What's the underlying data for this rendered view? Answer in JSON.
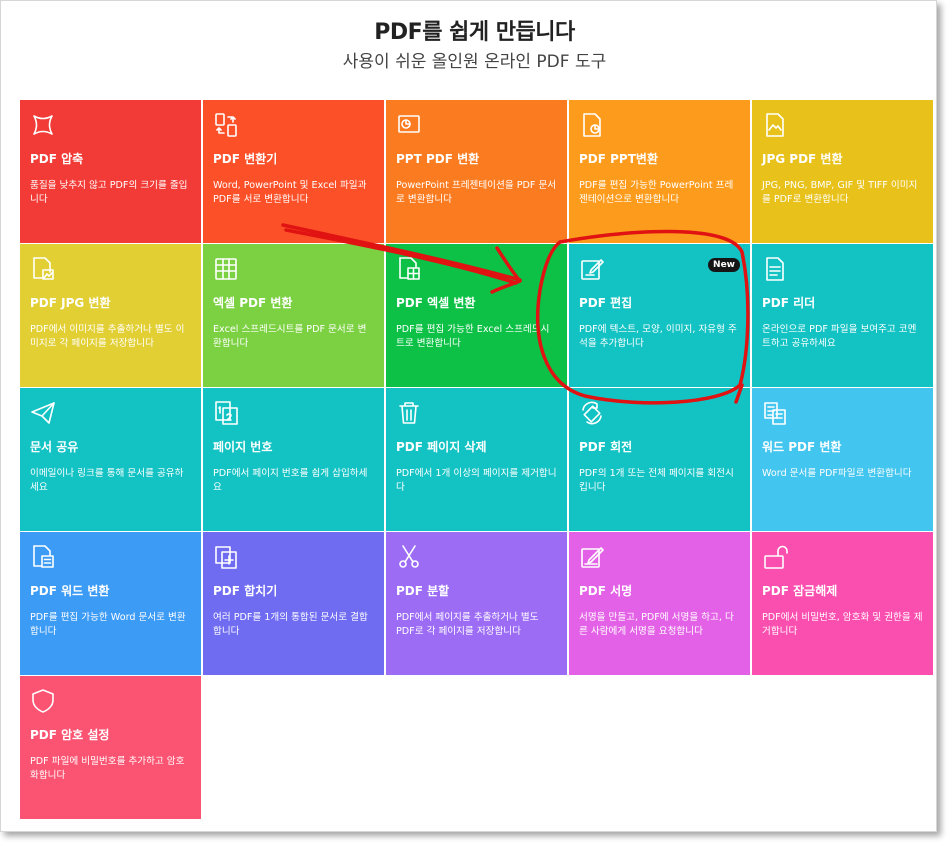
{
  "header": {
    "title": "PDF를 쉽게 만듭니다",
    "subtitle": "사용이 쉬운 올인원 온라인 PDF 도구"
  },
  "tools": [
    {
      "icon": "compress-icon",
      "name": "PDF 압축",
      "desc": "품질을 낮추지 않고 PDF의 크기를 줄입니다",
      "color": "#f23b36"
    },
    {
      "icon": "convert-icon",
      "name": "PDF 변환기",
      "desc": "Word, PowerPoint 및 Excel 파일과 PDF를 서로 변환합니다",
      "color": "#fb5028"
    },
    {
      "icon": "ppt-icon",
      "name": "PPT PDF 변환",
      "desc": "PowerPoint 프레젠테이션을 PDF 문서로 변환합니다",
      "color": "#fb7c20"
    },
    {
      "icon": "pdf-ppt-icon",
      "name": "PDF PPT변환",
      "desc": "PDF를 편집 가능한 PowerPoint 프레젠테이션으로 변환합니다",
      "color": "#fd9c1c"
    },
    {
      "icon": "image-icon",
      "name": "JPG PDF 변환",
      "desc": "JPG, PNG, BMP, GIF 및 TIFF 이미지를 PDF로 변환합니다",
      "color": "#e8c21a"
    },
    {
      "icon": "pdf-jpg-icon",
      "name": "PDF JPG 변환",
      "desc": "PDF에서 이미지를 추출하거나 별도 이미지로 각 페이지를 저장합니다",
      "color": "#e2cf33"
    },
    {
      "icon": "excel-icon",
      "name": "엑셀 PDF 변환",
      "desc": "Excel 스프레드시트를 PDF 문서로 변환합니다",
      "color": "#7cd142"
    },
    {
      "icon": "pdf-excel-icon",
      "name": "PDF 엑셀 변환",
      "desc": "PDF를 편집 가능한 Excel 스프레드시트로 변환합니다",
      "color": "#0cc145"
    },
    {
      "icon": "edit-icon",
      "name": "PDF 편집",
      "desc": "PDF에 텍스트, 모양, 이미지, 자유형 주석을 추가합니다",
      "color": "#13c3c4",
      "badge": "New"
    },
    {
      "icon": "reader-icon",
      "name": "PDF 리더",
      "desc": "온라인으로 PDF 파일을 보여주고 코멘트하고 공유하세요",
      "color": "#13c3c4"
    },
    {
      "icon": "share-icon",
      "name": "문서 공유",
      "desc": "이메일이나 링크를 통해 문서를 공유하세요",
      "color": "#13c3c4"
    },
    {
      "icon": "page-number-icon",
      "name": "페이지 번호",
      "desc": "PDF에서 페이지 번호를 쉽게 삽입하세요",
      "color": "#13c3c4"
    },
    {
      "icon": "trash-icon",
      "name": "PDF 페이지 삭제",
      "desc": "PDF에서 1개 이상의 페이지를 제거합니다",
      "color": "#13c3c4"
    },
    {
      "icon": "rotate-icon",
      "name": "PDF 회전",
      "desc": "PDF의 1개 또는 전체 페이지를 회전시킵니다",
      "color": "#13c3c4"
    },
    {
      "icon": "word-icon",
      "name": "워드 PDF 변환",
      "desc": "Word 문서를 PDF파일로 변환합니다",
      "color": "#42c5ee"
    },
    {
      "icon": "pdf-word-icon",
      "name": "PDF 워드 변환",
      "desc": "PDF를 편집 가능한 Word 문서로 변환합니다",
      "color": "#3c9bf5"
    },
    {
      "icon": "merge-icon",
      "name": "PDF 합치기",
      "desc": "여러 PDF를 1개의 통합된 문서로 결합합니다",
      "color": "#6f6cf2"
    },
    {
      "icon": "scissors-icon",
      "name": "PDF 분할",
      "desc": "PDF에서 페이지를 추출하거나 별도 PDF로 각 페이지를 저장합니다",
      "color": "#9c6cf5"
    },
    {
      "icon": "sign-icon",
      "name": "PDF 서명",
      "desc": "서명을 만들고, PDF에 서명을 하고, 다른 사람에게 서명을 요청합니다",
      "color": "#e361e6"
    },
    {
      "icon": "unlock-icon",
      "name": "PDF 잠금해제",
      "desc": "PDF에서 비밀번호, 암호화 및 권한을 제거합니다",
      "color": "#fb4fb0"
    },
    {
      "icon": "shield-icon",
      "name": "PDF 암호 설정",
      "desc": "PDF 파일에 비밀번호를 추가하고 암호화합니다",
      "color": "#fb5472"
    }
  ],
  "annotation": {
    "color": "#e01212"
  }
}
